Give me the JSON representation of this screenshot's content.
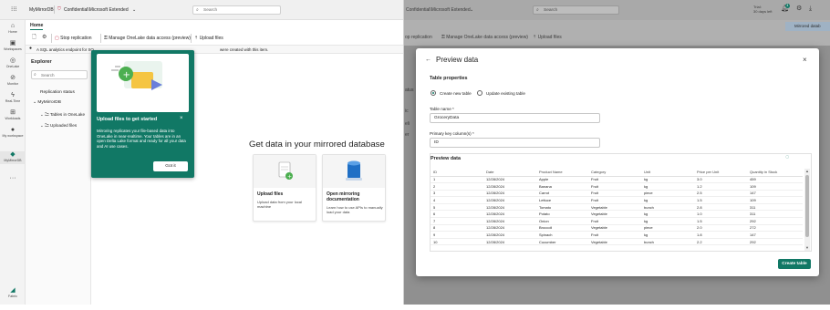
{
  "colors": {
    "accent": "#117865",
    "popover": "#117865"
  },
  "left": {
    "topbar": {
      "app_name": "MyMirrorDB",
      "sensitivity": "Confidential\\Microsoft Extended",
      "search_placeholder": "Search"
    },
    "nav": [
      {
        "label": "Home",
        "icon": "home-icon"
      },
      {
        "label": "Workspaces",
        "icon": "workspaces-icon"
      },
      {
        "label": "OneLake",
        "icon": "onelake-icon"
      },
      {
        "label": "Monitor",
        "icon": "monitor-icon"
      },
      {
        "label": "Real-Time",
        "icon": "realtime-icon"
      },
      {
        "label": "Workloads",
        "icon": "workloads-icon"
      },
      {
        "label": "My workspace",
        "icon": "my-workspace-icon"
      },
      {
        "label": "MyMirrorDB",
        "icon": "mirrordb-icon"
      }
    ],
    "nav_bottom": "Fabric",
    "ribbon": {
      "tab": "Home",
      "stop": "Stop replication",
      "manage": "Manage OneLake data access (preview)",
      "upload": "Upload files"
    },
    "info_text": "A SQL analytics endpoint for SQ",
    "info_text_right": "were created with this item.",
    "explorer": {
      "title": "Explorer",
      "search_placeholder": "Search",
      "replication_status": "Replication status",
      "db": "MyMirrorDB",
      "tables": "Tables in OneLake",
      "files": "Uploaded files"
    },
    "popover": {
      "title": "Upload files to get started",
      "body": "Mirroring replicates your file-based data into OneLake in near-realtime. Your tables are in an open Delta Lake format and ready for all your data and AI use cases.",
      "button": "Got it"
    },
    "main": {
      "heading": "Get data in your mirrored database",
      "card1_title": "Upload files",
      "card1_desc": "Upload data from your local machine",
      "card2_title": "Open mirroring documentation",
      "card2_desc": "Learn how to use APIs to manually load your data"
    }
  },
  "right": {
    "topbar": {
      "sensitivity": "Confidential\\Microsoft Extended",
      "search_placeholder": "Search",
      "trial_line1": "Trial:",
      "trial_line2": "30 days left",
      "notif_count": "4"
    },
    "ribbon": {
      "stop": "op replication",
      "manage": "Manage OneLake data access (preview)",
      "upload": "Upload files",
      "mirrored": "Mirrored datab"
    },
    "dialog": {
      "title": "Preview data",
      "table_properties": "Table properties",
      "radio_new": "Create new table",
      "radio_existing": "Update existing table",
      "table_name_label": "Table name *",
      "table_name_value": "GroceryData",
      "pk_label": "Primary key column(s) *",
      "pk_value": "ID",
      "preview_title": "Preview data",
      "create_button": "Create table",
      "columns": [
        "ID",
        "Date",
        "Product Name",
        "Category",
        "Unit",
        "Price per Unit",
        "Quantity in Stock"
      ],
      "rows": [
        [
          "1",
          "12/28/2024",
          "Apple",
          "Fruit",
          "kg",
          "3.0",
          "459"
        ],
        [
          "2",
          "12/28/2024",
          "Banana",
          "Fruit",
          "kg",
          "1.2",
          "109"
        ],
        [
          "3",
          "12/28/2024",
          "Carrot",
          "Fruit",
          "piece",
          "2.5",
          "147"
        ],
        [
          "4",
          "12/28/2024",
          "Lettuce",
          "Fruit",
          "kg",
          "1.5",
          "109"
        ],
        [
          "5",
          "12/28/2024",
          "Tomato",
          "Vegetable",
          "bunch",
          "2.8",
          "311"
        ],
        [
          "6",
          "12/28/2024",
          "Potato",
          "Vegetable",
          "kg",
          "1.0",
          "311"
        ],
        [
          "7",
          "12/28/2024",
          "Onion",
          "Fruit",
          "kg",
          "1.5",
          "292"
        ],
        [
          "8",
          "12/28/2024",
          "Broccoli",
          "Vegetable",
          "piece",
          "2.0",
          "272"
        ],
        [
          "9",
          "12/28/2024",
          "Spinach",
          "Fruit",
          "kg",
          "1.8",
          "147"
        ],
        [
          "10",
          "12/28/2024",
          "Cucumber",
          "Vegetable",
          "bunch",
          "2.2",
          "292"
        ]
      ]
    },
    "edge_labels": {
      "status": "atus",
      "ic": "ic",
      "eli": "eli",
      "er": "er"
    }
  }
}
